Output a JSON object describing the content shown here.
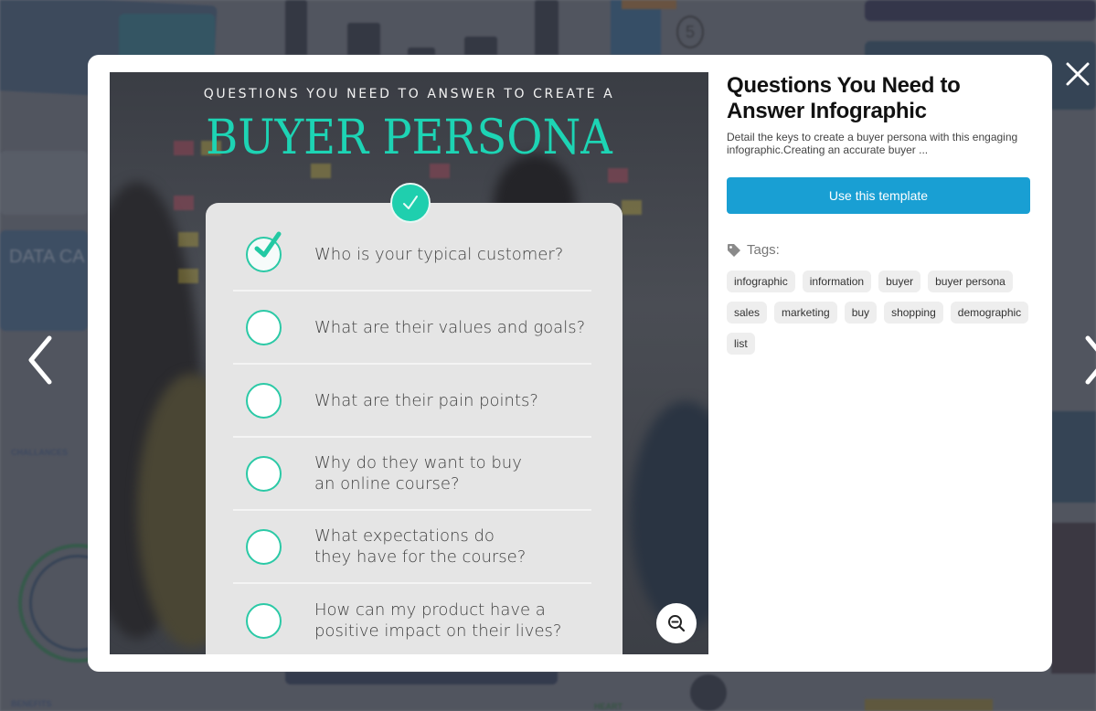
{
  "background": {
    "thumb_texts": [
      "DATA CA",
      "CHALLANCES",
      "BENEFITS",
      "HEART",
      "5"
    ]
  },
  "modal": {
    "preview": {
      "pre_title": "QUESTIONS YOU NEED TO ANSWER TO CREATE A",
      "title": "BUYER PERSONA",
      "questions": [
        {
          "text": "Who is your typical customer?",
          "checked": true
        },
        {
          "text": "What are their values and goals?",
          "checked": false
        },
        {
          "text": "What are their pain points?",
          "checked": false
        },
        {
          "text": "Why do they want to buy an online course?",
          "line1": "Why do they want to buy",
          "line2": "an online course?",
          "checked": false
        },
        {
          "text": "What expectations do they have for the course?",
          "line1": "What expectations do",
          "line2": "they have for the course?",
          "checked": false
        },
        {
          "text": "How can my product have a positive impact on their lives?",
          "line1": "How can my product have a",
          "line2": "positive impact on their lives?",
          "checked": false
        }
      ],
      "zoom_icon": "zoom-out-icon"
    },
    "info": {
      "title": "Questions You Need to Answer Infographic",
      "description": "Detail the keys to create a buyer persona with this engaging infographic.Creating an accurate buyer ...",
      "use_button": "Use this template",
      "tags_label": "Tags:",
      "tags": [
        "infographic",
        "information",
        "buyer",
        "buyer persona",
        "sales",
        "marketing",
        "buy",
        "shopping",
        "demographic",
        "list"
      ]
    }
  },
  "controls": {
    "prev_icon": "chevron-left-icon",
    "next_icon": "chevron-right-icon",
    "close_icon": "close-icon"
  },
  "colors": {
    "accent_teal": "#1dd4b4",
    "button_blue": "#199fd3",
    "tag_bg": "#eeeeee"
  }
}
